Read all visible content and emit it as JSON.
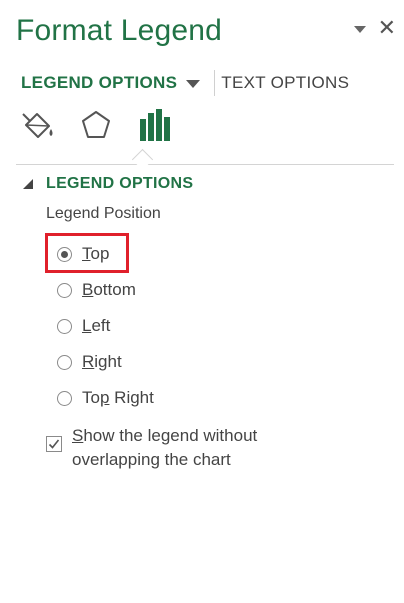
{
  "pane": {
    "title": "Format Legend"
  },
  "tabs": {
    "legend_options": "LEGEND OPTIONS",
    "text_options": "TEXT OPTIONS"
  },
  "icons": [
    "fill-line-icon",
    "effects-icon",
    "legend-options-icon"
  ],
  "section": {
    "title": "LEGEND OPTIONS",
    "group_label": "Legend Position"
  },
  "radio_options": [
    {
      "first": "T",
      "rest": "op",
      "checked": true
    },
    {
      "first": "B",
      "rest": "ottom",
      "checked": false
    },
    {
      "first": "L",
      "rest": "eft",
      "checked": false
    },
    {
      "first": "R",
      "rest": "ight",
      "checked": false
    },
    {
      "pre": "To",
      "mn": "p",
      "post": " Right",
      "checked": false
    }
  ],
  "checkbox": {
    "first": "S",
    "rest": "how the legend without overlapping the chart",
    "checked": true
  },
  "colors": {
    "accent": "#217346",
    "highlight": "#e0202b",
    "text": "#444444"
  }
}
